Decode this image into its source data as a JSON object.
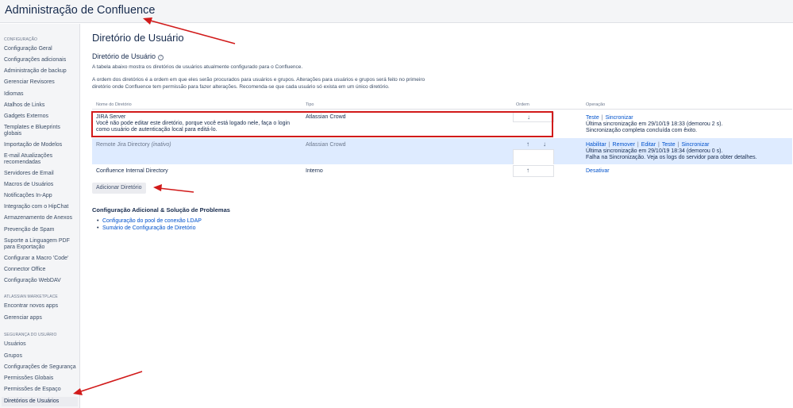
{
  "app": {
    "title": "Administração de Confluence"
  },
  "sidebar": {
    "sections": [
      {
        "heading": "CONFIGURAÇÃO",
        "items": [
          "Configuração Geral",
          "Configurações adicionais",
          "Administração de backup",
          "Gerenciar Revisores",
          "Idiomas",
          "Atalhos de Links",
          "Gadgets Externos",
          "Templates e Blueprints globais",
          "Importação de Modelos",
          "E-mail Atualizações recomendadas",
          "Servidores de Email",
          "Macros de Usuários",
          "Notificações In-App",
          "Integração com o HipChat",
          "Armazenamento de Anexos",
          "Prevenção de Spam",
          "Suporte a Linguagem PDF para Exportação",
          "Configurar a Macro 'Code'",
          "Connector Office",
          "Configuração WebDAV"
        ]
      },
      {
        "heading": "ATLASSIAN MARKETPLACE",
        "items": [
          "Encontrar novos apps",
          "Gerenciar apps"
        ]
      },
      {
        "heading": "SEGURANÇA DO USUÁRIO",
        "items": [
          "Usuários",
          "Grupos",
          "Configurações de Segurança",
          "Permissões Globais",
          "Permissões de Espaço",
          "Diretórios de Usuários"
        ]
      }
    ],
    "active_item": "Diretórios de Usuários"
  },
  "main": {
    "page_title": "Diretório de Usuário",
    "section_title": "Diretório de Usuário",
    "help_icon": "help-circle-icon",
    "help_glyph": "?",
    "description_1": "A tabela abaixo mostra os diretórios de usuários atualmente configurado para o Confluence.",
    "description_2": "A ordem dos diretórios é a ordem em que eles serão procurados para usuários e grupos. Alterações para usuários e grupos será feito no primeiro diretório onde Confluence tem permissão para fazer alterações. Recomenda-se que cada usuário só exista em um único diretório.",
    "table": {
      "headers": {
        "name": "Nome do Diretório",
        "type": "Tipo",
        "order": "Ordem",
        "operation": "Operação"
      },
      "rows": [
        {
          "name": "JIRA Server",
          "note": "Você não pode editar este diretório, porque você está logado nele, faça o login como usuário de autenticação local para editá-lo.",
          "type": "Atlassian Crowd",
          "order_glyphs": {
            "down": "↓"
          },
          "operations": [
            "Teste",
            "Sincronizar"
          ],
          "status": [
            "Última sincronização em 29/10/19 18:33 (demorou 2 s).",
            "Sincronização completa concluída com êxito."
          ]
        },
        {
          "name": "Remote Jira Directory",
          "name_suffix": "(inativo)",
          "type": "Atlassian Crowd",
          "order_glyphs": {
            "up": "↑",
            "down": "↓"
          },
          "operations": [
            "Habilitar",
            "Remover",
            "Editar",
            "Teste",
            "Sincronizar"
          ],
          "status": [
            "Última sincronização em 29/10/19 18:34 (demorou 0 s).",
            "Falha na Sincronização. Veja os logs do servidor para obter detalhes."
          ]
        },
        {
          "name": "Confluence Internal Directory",
          "type": "Interno",
          "order_glyphs": {
            "up": "↑"
          },
          "operations": [
            "Desativar"
          ]
        }
      ]
    },
    "add_button": "Adicionar Diretório",
    "additional": {
      "title": "Configuração Adicional & Solução de Problemas",
      "links": [
        "Configuração do pool de conexão LDAP",
        "Sumário de Configuração de Diretório"
      ]
    }
  },
  "colors": {
    "annotation_red": "#d11a1a",
    "link_blue": "#0052cc",
    "row_highlight": "#deebff"
  }
}
